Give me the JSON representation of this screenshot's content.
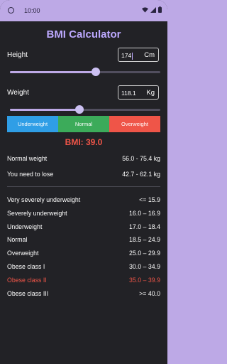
{
  "status": {
    "time": "10:00"
  },
  "app": {
    "title": "BMI Calculator"
  },
  "height": {
    "label": "Height",
    "value": "174",
    "unit": "Cm",
    "slider": 0.57
  },
  "weight": {
    "label": "Weight",
    "value": "118.1",
    "unit": "Kg",
    "slider": 0.46
  },
  "categories": [
    {
      "label": "Underweight",
      "color": "#2f9ee6"
    },
    {
      "label": "Normal",
      "color": "#3cab5a"
    },
    {
      "label": "Overweight",
      "color": "#ef5548"
    }
  ],
  "result": {
    "bmi_text": "BMI: 39.0",
    "color": "#ef5548"
  },
  "summary": [
    {
      "label": "Normal weight",
      "value": "56.0 - 75.4 kg"
    },
    {
      "label": "You need to lose",
      "value": "42.7 - 62.1 kg"
    }
  ],
  "table": [
    {
      "label": "Very severely underweight",
      "range": "<= 15.9",
      "highlight": false
    },
    {
      "label": "Severely underweight",
      "range": "16.0 – 16.9",
      "highlight": false
    },
    {
      "label": "Underweight",
      "range": "17.0 – 18.4",
      "highlight": false
    },
    {
      "label": "Normal",
      "range": "18.5 – 24.9",
      "highlight": false
    },
    {
      "label": "Overweight",
      "range": "25.0 – 29.9",
      "highlight": false
    },
    {
      "label": "Obese class I",
      "range": "30.0 – 34.9",
      "highlight": false
    },
    {
      "label": "Obese class II",
      "range": "35.0 – 39.9",
      "highlight": true
    },
    {
      "label": "Obese class III",
      "range": ">= 40.0",
      "highlight": false
    }
  ],
  "colors": {
    "accent": "#bda9e6",
    "title": "#bda9ff",
    "highlight": "#ef5548",
    "background": "#222226"
  }
}
